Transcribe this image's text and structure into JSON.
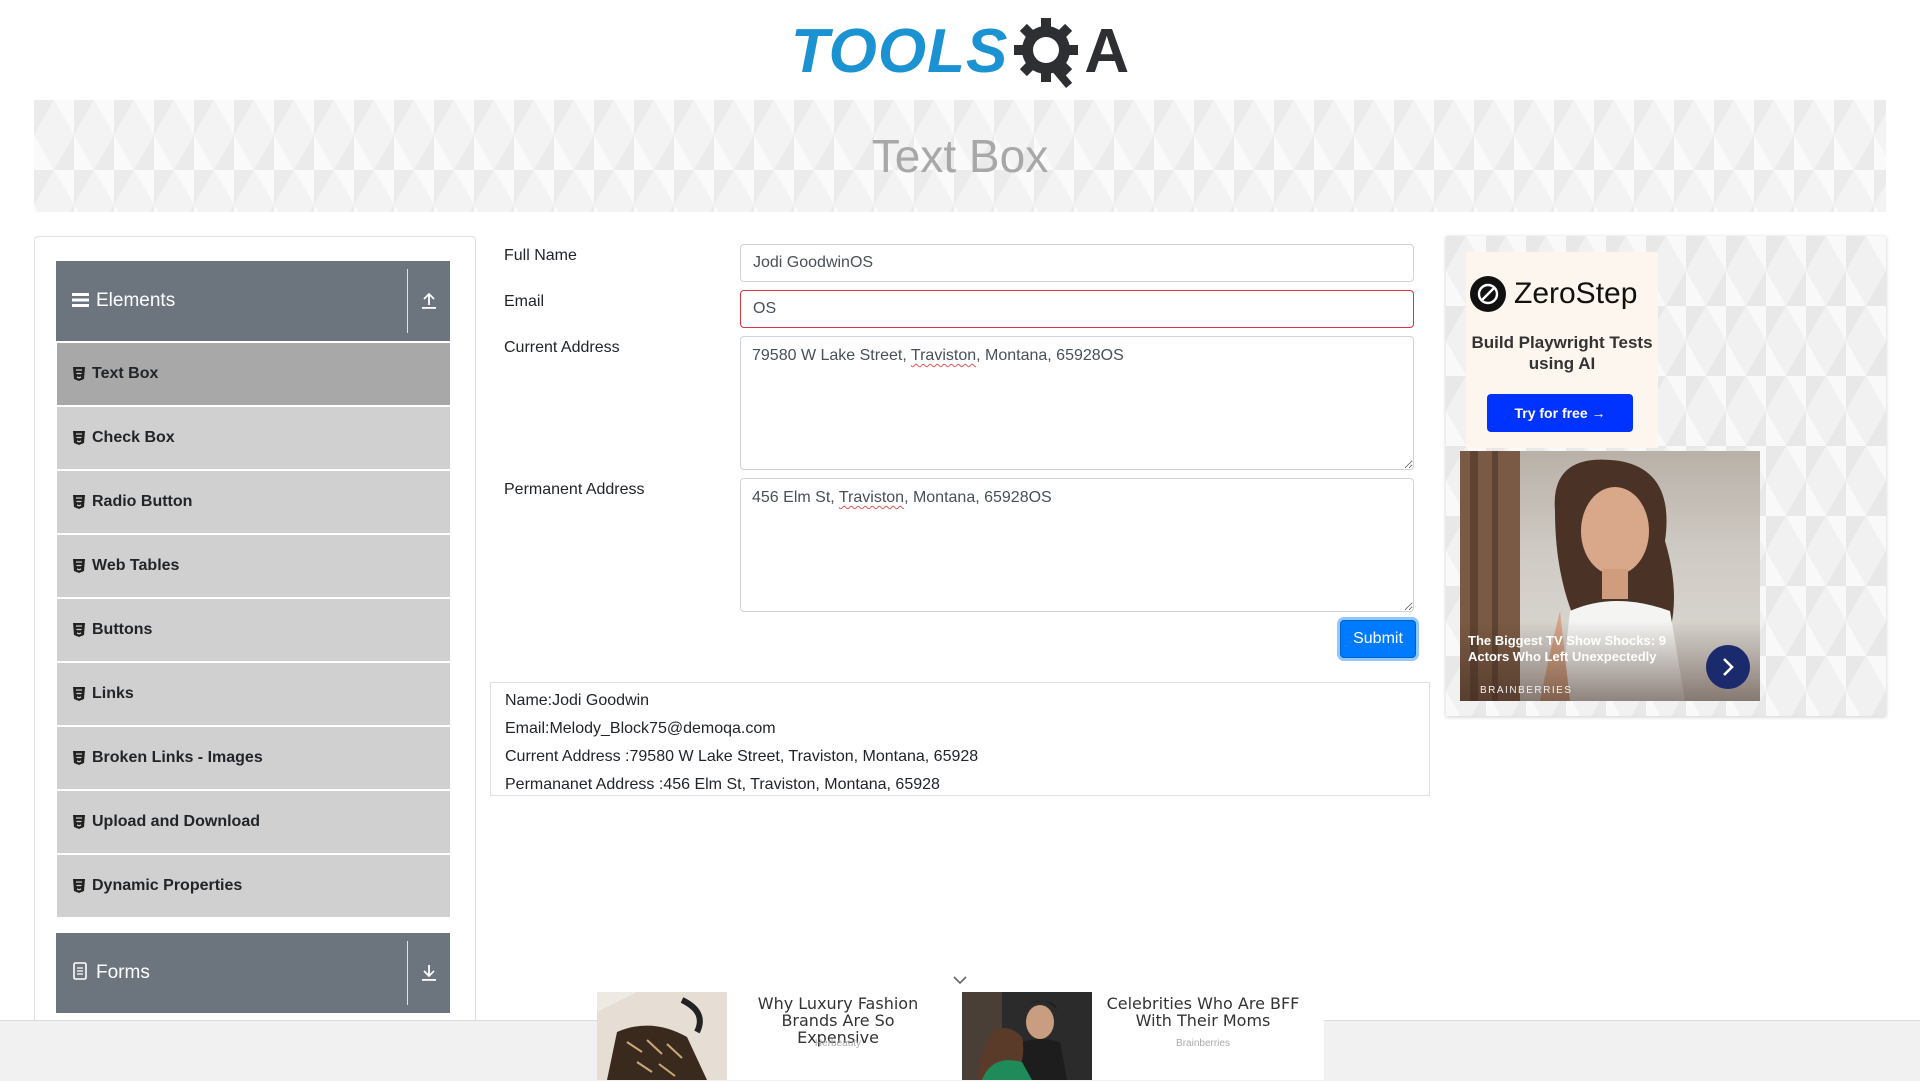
{
  "header": {
    "logo_text_left": "TOOLS",
    "logo_text_right": "A",
    "page_title": "Text Box"
  },
  "sidebar": {
    "groups": [
      {
        "label": "Elements",
        "icon": "hamburger-icon",
        "arrow": "collapse-up-icon"
      },
      {
        "label": "Forms",
        "icon": "document-icon",
        "arrow": "expand-down-icon"
      }
    ],
    "items": [
      {
        "label": "Text Box",
        "active": true
      },
      {
        "label": "Check Box"
      },
      {
        "label": "Radio Button"
      },
      {
        "label": "Web Tables"
      },
      {
        "label": "Buttons"
      },
      {
        "label": "Links"
      },
      {
        "label": "Broken Links - Images"
      },
      {
        "label": "Upload and Download"
      },
      {
        "label": "Dynamic Properties"
      }
    ]
  },
  "form": {
    "full_name_label": "Full Name",
    "full_name_value": "Jodi GoodwinOS",
    "email_label": "Email",
    "email_value": "OS",
    "current_address_label": "Current Address",
    "current_address_value": {
      "before": "79580 W Lake Street, ",
      "misspelled": "Traviston",
      "after": ", Montana, 65928OS"
    },
    "permanent_address_label": "Permanent Address",
    "permanent_address_value": {
      "before": "456 Elm St, ",
      "misspelled": "Traviston",
      "after": ", Montana, 65928OS"
    },
    "submit_label": "Submit"
  },
  "output": {
    "name": "Name:Jodi Goodwin",
    "email": "Email:Melody_Block75@demoqa.com",
    "current_address": "Current Address :79580 W Lake Street, Traviston, Montana, 65928",
    "permanent_address": "Permananet Address :456 Elm St, Traviston, Montana, 65928"
  },
  "right_ad": {
    "brand": "ZeroStep",
    "tagline": "Build Playwright Tests using AI",
    "cta": "Try for free →",
    "story_caption": "The Biggest TV Show Shocks: 9 Actors Who Left Unexpectedly",
    "story_source": "BRAINBERRIES"
  },
  "bottom_ads": [
    {
      "title": "Why Luxury Fashion Brands Are So Expensive",
      "source": "Herbeauty"
    },
    {
      "title": "Celebrities Who Are BFF With Their Moms",
      "source": "Brainberries"
    }
  ],
  "colors": {
    "brand_blue": "#1b92d1",
    "sidebar_header": "#6c757d",
    "menu_item": "#d0d0d0",
    "menu_item_active": "#a8a8a8",
    "submit": "#007bff",
    "error_border": "#dc3545",
    "cta_blue": "#0033ff"
  }
}
